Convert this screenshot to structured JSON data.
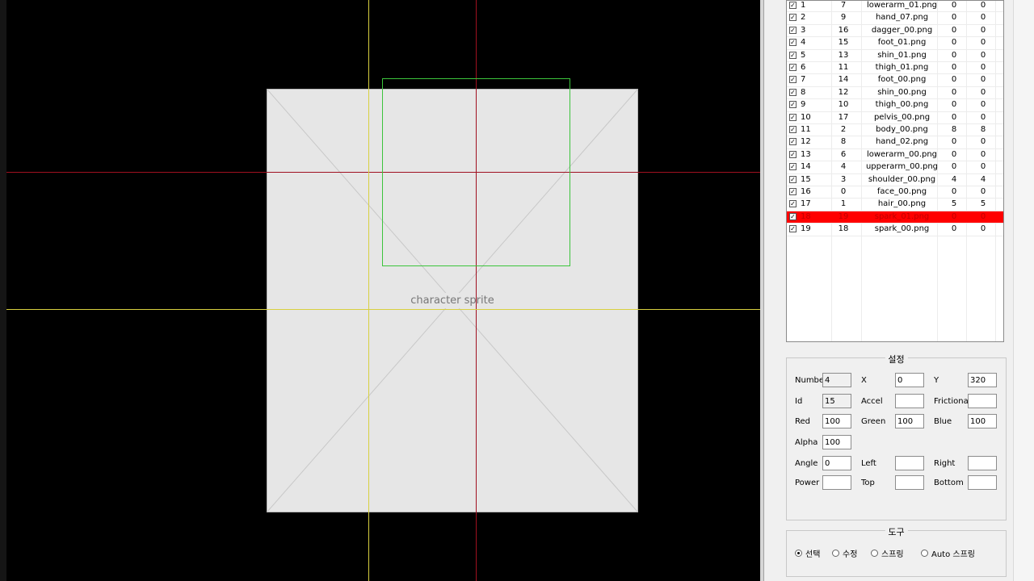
{
  "layers": {
    "rows": [
      {
        "no": "1",
        "id": "7",
        "file": "lowerarm_01.png",
        "x": "0",
        "y": "0",
        "checked": true
      },
      {
        "no": "2",
        "id": "9",
        "file": "hand_07.png",
        "x": "0",
        "y": "0",
        "checked": true
      },
      {
        "no": "3",
        "id": "16",
        "file": "dagger_00.png",
        "x": "0",
        "y": "0",
        "checked": true
      },
      {
        "no": "4",
        "id": "15",
        "file": "foot_01.png",
        "x": "0",
        "y": "0",
        "checked": true
      },
      {
        "no": "5",
        "id": "13",
        "file": "shin_01.png",
        "x": "0",
        "y": "0",
        "checked": true
      },
      {
        "no": "6",
        "id": "11",
        "file": "thigh_01.png",
        "x": "0",
        "y": "0",
        "checked": true
      },
      {
        "no": "7",
        "id": "14",
        "file": "foot_00.png",
        "x": "0",
        "y": "0",
        "checked": true
      },
      {
        "no": "8",
        "id": "12",
        "file": "shin_00.png",
        "x": "0",
        "y": "0",
        "checked": true
      },
      {
        "no": "9",
        "id": "10",
        "file": "thigh_00.png",
        "x": "0",
        "y": "0",
        "checked": true
      },
      {
        "no": "10",
        "id": "17",
        "file": "pelvis_00.png",
        "x": "0",
        "y": "0",
        "checked": true
      },
      {
        "no": "11",
        "id": "2",
        "file": "body_00.png",
        "x": "8",
        "y": "8",
        "checked": true
      },
      {
        "no": "12",
        "id": "8",
        "file": "hand_02.png",
        "x": "0",
        "y": "0",
        "checked": true
      },
      {
        "no": "13",
        "id": "6",
        "file": "lowerarm_00.png",
        "x": "0",
        "y": "0",
        "checked": true
      },
      {
        "no": "14",
        "id": "4",
        "file": "upperarm_00.png",
        "x": "0",
        "y": "0",
        "checked": true
      },
      {
        "no": "15",
        "id": "3",
        "file": "shoulder_00.png",
        "x": "4",
        "y": "4",
        "checked": true
      },
      {
        "no": "16",
        "id": "0",
        "file": "face_00.png",
        "x": "0",
        "y": "0",
        "checked": true
      },
      {
        "no": "17",
        "id": "1",
        "file": "hair_00.png",
        "x": "5",
        "y": "5",
        "checked": true
      },
      {
        "no": "18",
        "id": "19",
        "file": "spark_01.png",
        "x": "0",
        "y": "0",
        "checked": true,
        "selected": true
      },
      {
        "no": "19",
        "id": "18",
        "file": "spark_00.png",
        "x": "0",
        "y": "0",
        "checked": true
      }
    ]
  },
  "settings": {
    "title": "설정",
    "fields": [
      {
        "key": "number",
        "label": "Number",
        "value": "4",
        "readonly": true
      },
      {
        "key": "x",
        "label": "X",
        "value": "0"
      },
      {
        "key": "y",
        "label": "Y",
        "value": "320"
      },
      {
        "key": "id",
        "label": "Id",
        "value": "15",
        "readonly": true
      },
      {
        "key": "accel",
        "label": "Accel",
        "value": ""
      },
      {
        "key": "frictional",
        "label": "Frictional",
        "value": ""
      },
      {
        "key": "red",
        "label": "Red",
        "value": "100"
      },
      {
        "key": "green",
        "label": "Green",
        "value": "100"
      },
      {
        "key": "blue",
        "label": "Blue",
        "value": "100"
      },
      {
        "key": "alpha",
        "label": "Alpha",
        "value": "100"
      },
      {
        "key": "angle",
        "label": "Angle",
        "value": "0"
      },
      {
        "key": "left",
        "label": "Left",
        "value": ""
      },
      {
        "key": "right",
        "label": "Right",
        "value": ""
      },
      {
        "key": "power",
        "label": "Power",
        "value": ""
      },
      {
        "key": "top",
        "label": "Top",
        "value": ""
      },
      {
        "key": "bottom",
        "label": "Bottom",
        "value": ""
      }
    ]
  },
  "tools": {
    "title": "도구",
    "options": [
      {
        "label": "선택",
        "selected": true
      },
      {
        "label": "수정",
        "selected": false
      },
      {
        "label": "스프링",
        "selected": false
      },
      {
        "label": "Auto 스프링",
        "selected": false
      }
    ]
  },
  "canvas": {
    "sprite_label": "character sprite",
    "guide_colors": {
      "yellow": "#d8d040",
      "red": "#a01020",
      "selection": "#3cc43c"
    }
  },
  "colors": {
    "selected_row": "#ff0000"
  }
}
